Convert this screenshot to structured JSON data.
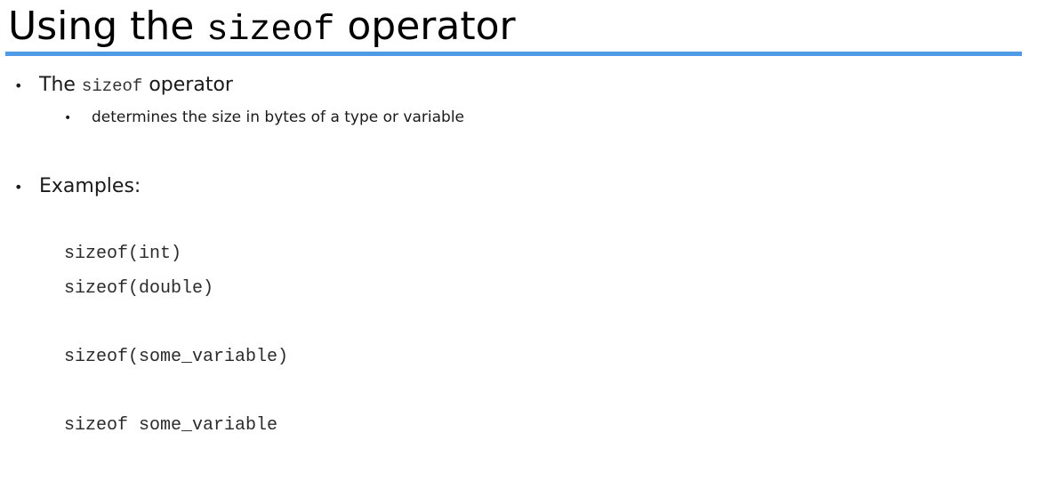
{
  "slide": {
    "title": {
      "prefix": "Using the ",
      "code": "sizeof",
      "suffix": " operator"
    },
    "bullets": [
      {
        "prefix": "The ",
        "code": "sizeof",
        "suffix": " operator",
        "sub": "determines the size in bytes of a type or variable"
      },
      {
        "text": "Examples:"
      }
    ],
    "code_examples": [
      "sizeof(int)",
      "sizeof(double)",
      "sizeof(some_variable)",
      "sizeof some_variable"
    ],
    "colors": {
      "title_rule": "#4f9be6"
    }
  }
}
